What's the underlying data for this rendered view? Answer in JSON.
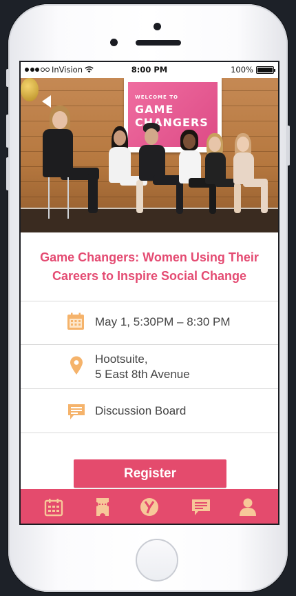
{
  "status_bar": {
    "carrier": "InVision",
    "time": "8:00 PM",
    "battery_percent": "100%"
  },
  "hero": {
    "screen_line1": "WELCOME TO",
    "screen_line2": "GAME CHANGERS"
  },
  "event": {
    "title": "Game Changers: Women Using Their Careers to Inspire Social Change"
  },
  "details": [
    {
      "icon": "calendar-icon",
      "text": "May 1, 5:30PM – 8:30 PM"
    },
    {
      "icon": "location-pin-icon",
      "line1": "Hootsuite,",
      "line2": "5 East 8th Avenue"
    },
    {
      "icon": "chat-bubble-icon",
      "text": "Discussion Board"
    }
  ],
  "actions": {
    "register_label": "Register"
  },
  "tabbar": [
    {
      "icon": "calendar-icon"
    },
    {
      "icon": "ticket-icon"
    },
    {
      "icon": "y-logo-icon"
    },
    {
      "icon": "chat-bubble-icon"
    },
    {
      "icon": "profile-icon"
    }
  ],
  "colors": {
    "accent": "#e44b6d",
    "title": "#e44b72",
    "icon": "#f5b36b"
  }
}
